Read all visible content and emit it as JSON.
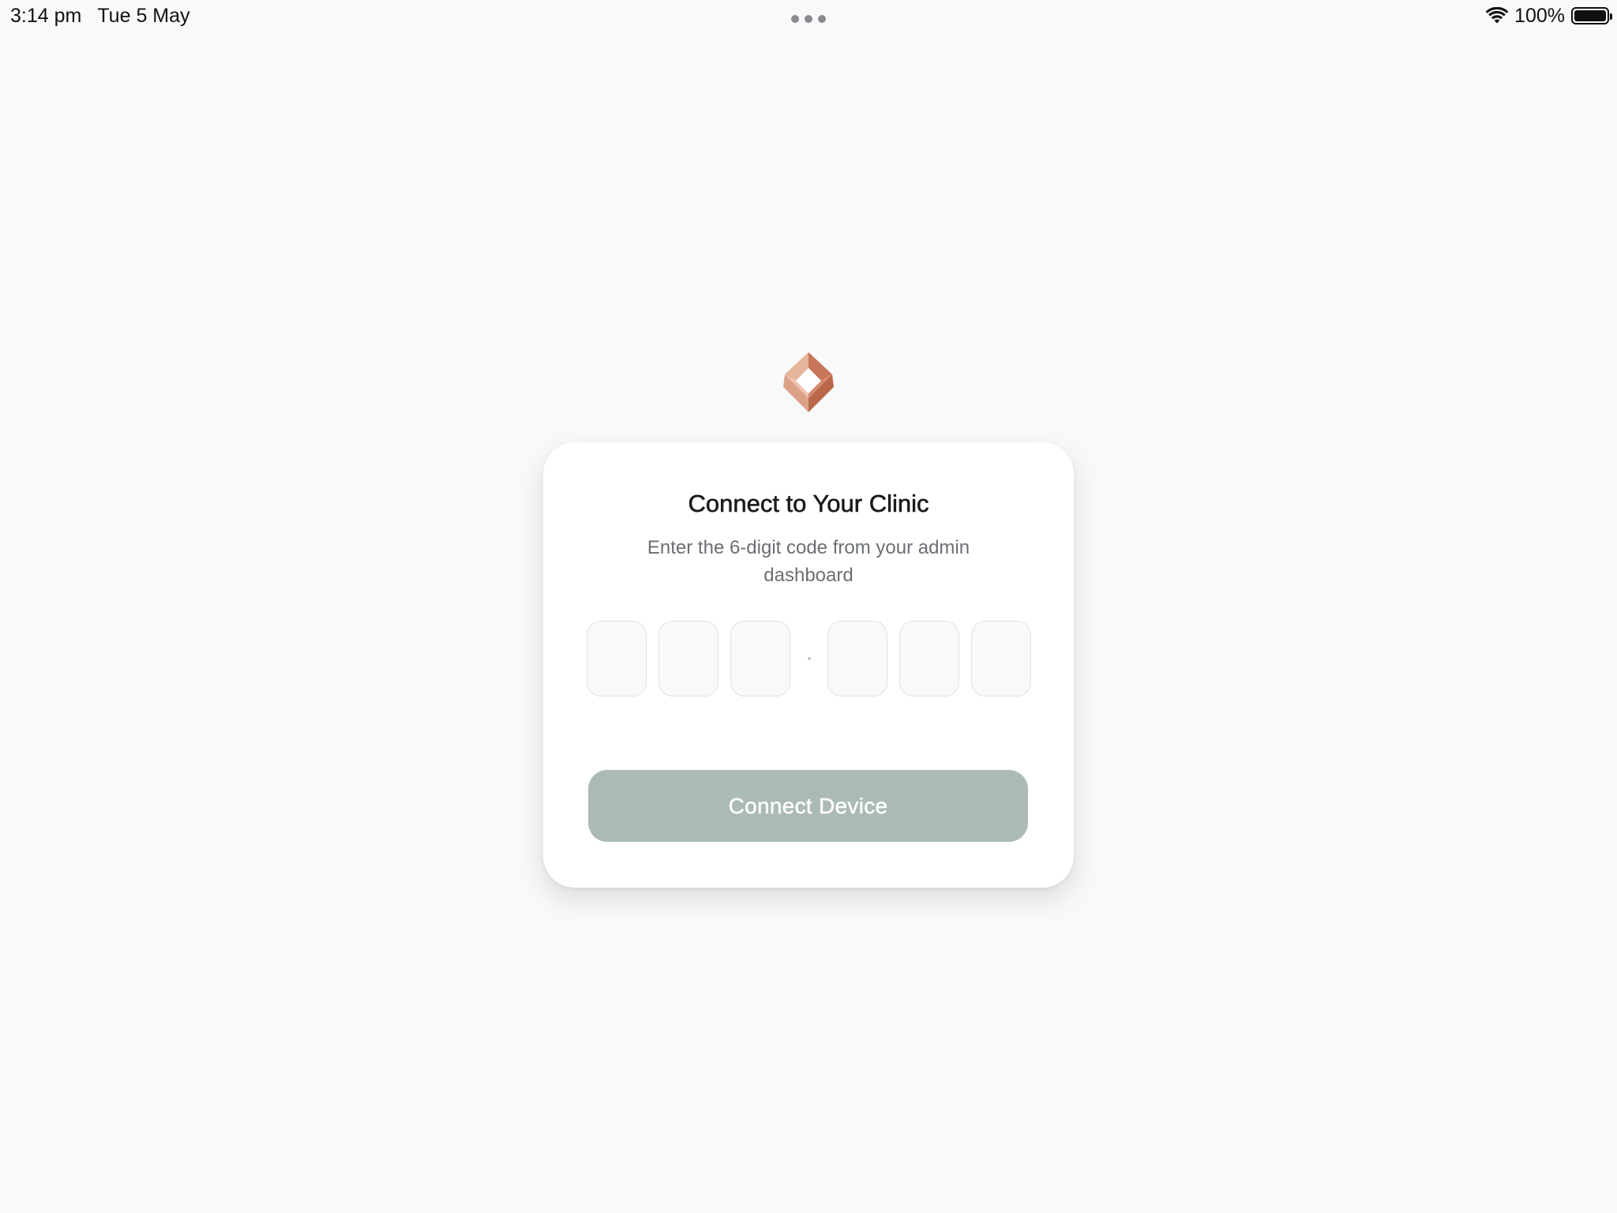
{
  "status_bar": {
    "time": "3:14 pm",
    "date": "Tue 5 May",
    "battery_percent": "100%",
    "battery_level": 1.0,
    "icons": [
      "multitasking-dots-icon",
      "wifi-icon",
      "battery-icon"
    ]
  },
  "logo": {
    "icon": "clinic-logo-icon",
    "colors": [
      "#e2ad90",
      "#c8775a",
      "#dda085"
    ]
  },
  "card": {
    "title": "Connect to Your Clinic",
    "subtitle": "Enter the 6-digit code from your admin dashboard",
    "code": {
      "digits": [
        "",
        "",
        "",
        "",
        "",
        ""
      ],
      "length": 6
    },
    "connect_button": {
      "label": "Connect Device",
      "enabled": false,
      "color": "#abbab6"
    }
  },
  "colors": {
    "background": "#f8f9fb",
    "card": "#ffffff",
    "title": "#1b1b1d",
    "subtitle": "#6b6f73",
    "input_border": "#dfe1e4"
  }
}
